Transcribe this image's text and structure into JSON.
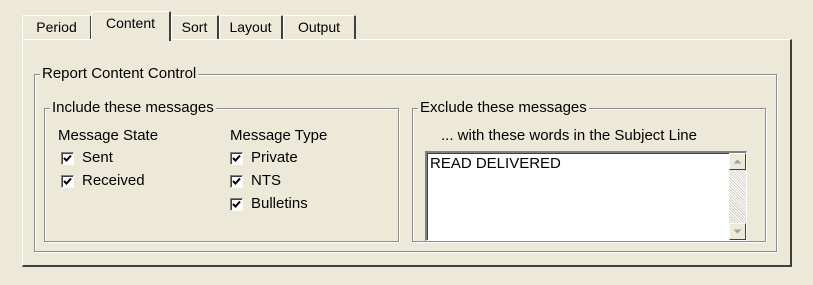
{
  "tabs": [
    {
      "label": "Period"
    },
    {
      "label": "Content"
    },
    {
      "label": "Sort"
    },
    {
      "label": "Layout"
    },
    {
      "label": "Output"
    }
  ],
  "active_tab": "Content",
  "report_group": {
    "title": "Report Content Control"
  },
  "include_group": {
    "title": "Include these messages",
    "state_heading": "Message State",
    "type_heading": "Message Type",
    "state_options": [
      {
        "label": "Sent",
        "checked": true
      },
      {
        "label": "Received",
        "checked": true
      }
    ],
    "type_options": [
      {
        "label": "Private",
        "checked": true
      },
      {
        "label": "NTS",
        "checked": true
      },
      {
        "label": "Bulletins",
        "checked": true
      }
    ]
  },
  "exclude_group": {
    "title": "Exclude these messages",
    "subtitle": "... with these words in the Subject Line",
    "words_value": "READ DELIVERED"
  },
  "icons": {
    "scroll_up": "arrow-up-icon",
    "scroll_down": "arrow-down-icon",
    "check": "checkmark-icon"
  }
}
